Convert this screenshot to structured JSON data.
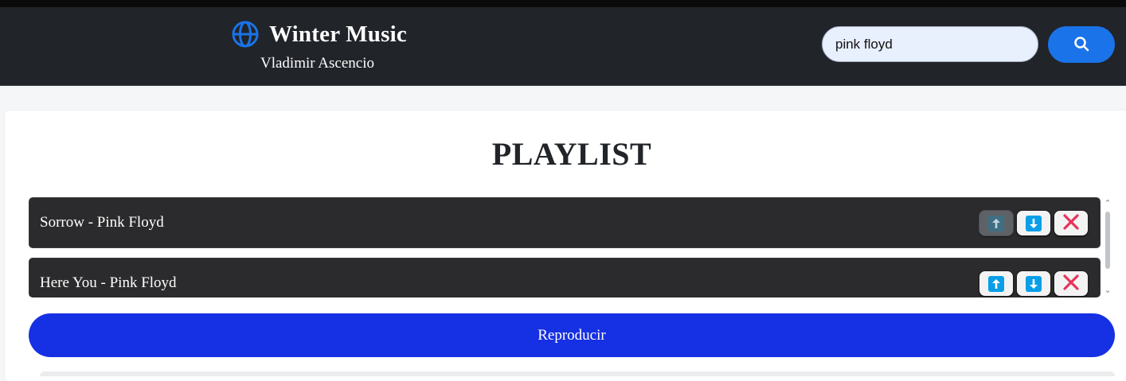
{
  "header": {
    "title": "Winter Music",
    "subtitle": "Vladimir Ascencio",
    "logo_icon": "globe-icon",
    "accent_color": "#1a73e8"
  },
  "search": {
    "value": "pink floyd",
    "button_icon": "search-icon"
  },
  "playlist": {
    "title": "PLAYLIST",
    "items": [
      {
        "label": "Sorrow - Pink Floyd",
        "move_up_enabled": false,
        "move_down_enabled": true
      },
      {
        "label": "Here You - Pink Floyd",
        "move_up_enabled": true,
        "move_down_enabled": true
      }
    ],
    "control_icons": [
      "arrow-up-icon",
      "arrow-down-icon",
      "close-icon"
    ],
    "play_button_label": "Reproducir",
    "play_button_color": "#1630e3"
  }
}
